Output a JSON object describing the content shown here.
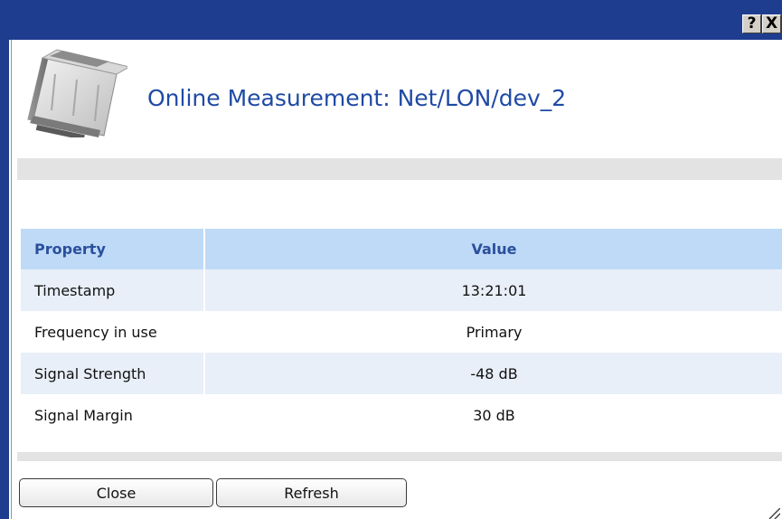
{
  "titlebar": {
    "help_label": "?",
    "close_label": "X"
  },
  "dialog": {
    "title": "Online Measurement: Net/LON/dev_2",
    "icon": "device-module-icon"
  },
  "table": {
    "headers": [
      "Property",
      "Value"
    ],
    "rows": [
      {
        "property": "Timestamp",
        "value": "13:21:01"
      },
      {
        "property": "Frequency in use",
        "value": "Primary"
      },
      {
        "property": "Signal Strength",
        "value": "-48 dB"
      },
      {
        "property": "Signal Margin",
        "value": "30 dB"
      }
    ]
  },
  "buttons": {
    "close_label": "Close",
    "refresh_label": "Refresh"
  },
  "colors": {
    "titlebar": "#1f3d8f",
    "title_text": "#1f4aa5",
    "table_header_bg": "#bfdaf7",
    "table_alt_row_bg": "#e9eff8",
    "separator": "#e3e3e3"
  }
}
